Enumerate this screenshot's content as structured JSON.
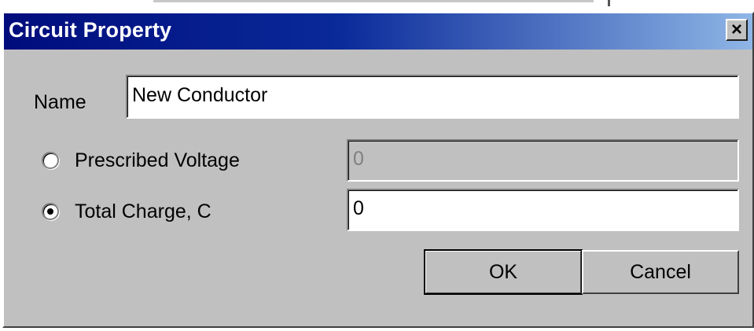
{
  "dialog": {
    "title": "Circuit Property",
    "close_label": "×"
  },
  "name": {
    "label": "Name",
    "value": "New Conductor"
  },
  "options": {
    "prescribed_voltage": {
      "label": "Prescribed Voltage",
      "value": "0",
      "selected": false,
      "enabled": false
    },
    "total_charge": {
      "label": "Total Charge, C",
      "value": "0",
      "selected": true,
      "enabled": true
    }
  },
  "buttons": {
    "ok": "OK",
    "cancel": "Cancel"
  }
}
